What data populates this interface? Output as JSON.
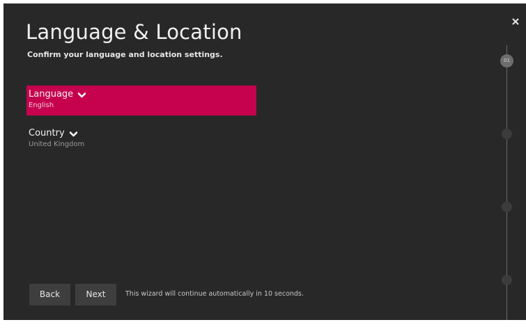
{
  "header": {
    "title": "Language & Location",
    "subtitle": "Confirm your language and location settings."
  },
  "settings": [
    {
      "label": "Language",
      "value": "English",
      "selected": true
    },
    {
      "label": "Country",
      "value": "United Kingdom",
      "selected": false
    }
  ],
  "steps": {
    "current_label": "01",
    "total": 4,
    "current": 1
  },
  "footer": {
    "back_label": "Back",
    "next_label": "Next",
    "auto_message": "This wizard will continue automatically in 10 seconds."
  },
  "icons": {
    "close": "close-icon",
    "chevron": "chevron-down-icon"
  },
  "colors": {
    "background": "#282828",
    "accent": "#c6024e",
    "button": "#3e3e3e"
  }
}
